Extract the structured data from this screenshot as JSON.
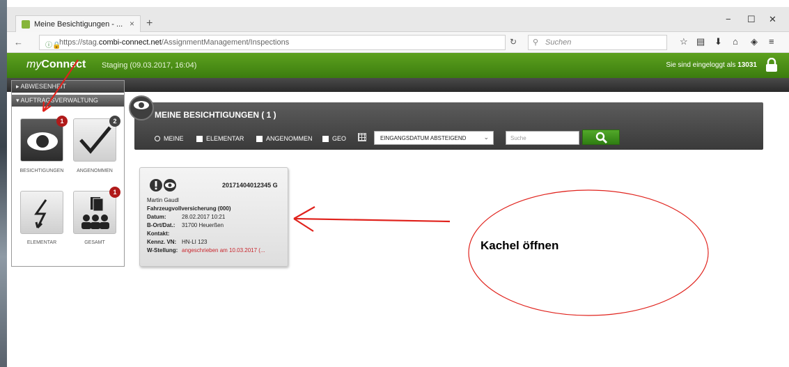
{
  "browser": {
    "tab_title": "Meine Besichtigungen - ...",
    "url_prefix": "https://stag.",
    "url_host": "combi-connect.net",
    "url_path": "/AssignmentManagement/Inspections",
    "search_placeholder": "Suchen"
  },
  "app": {
    "logo_prefix": "my",
    "logo_name": "Connect",
    "environment": "Staging (09.03.2017, 16:04)",
    "login_text": "Sie sind eingeloggt als",
    "login_user": "13031",
    "accent_color": "#3b7c0e"
  },
  "sidebar": {
    "section_1": "ABWESENHEIT",
    "section_2": "AUFTRAGSVERWALTUNG",
    "tiles": [
      {
        "label": "BESICHTIGUNGEN",
        "badge": "1",
        "icon": "eye-icon"
      },
      {
        "label": "ANGENOMMEN",
        "badge": "2",
        "icon": "checkmark-icon"
      },
      {
        "label": "ELEMENTAR",
        "badge": "",
        "icon": "lightning-icon"
      },
      {
        "label": "GESAMT",
        "badge": "1",
        "icon": "group-icon"
      }
    ]
  },
  "panel": {
    "title": "MEINE BESICHTIGUNGEN ( 1 )",
    "filters": {
      "meine": "MEINE",
      "elementar": "ELEMENTAR",
      "angenommen": "ANGENOMMEN",
      "geo": "GEO"
    },
    "sort_value": "EINGANGSDATUM ABSTEIGEND",
    "search_placeholder": "Suche"
  },
  "card": {
    "id": "20171404012345 G",
    "name": "Martin Gaudl",
    "product": "Fahrzeugvollversicherung (000)",
    "datum_label": "Datum:",
    "datum": "28.02.2017 10:21",
    "ort_label": "B-Ort/Dat.:",
    "ort": "31700 Heuerßen",
    "kontakt_label": "Kontakt:",
    "kennz_label": "Kennz. VN:",
    "kennz": "HN-LI 123",
    "w_label": "W-Stellung:",
    "w_value": "angeschrieben am 10.03.2017 (..."
  },
  "annotation": {
    "note": "Kachel öffnen"
  }
}
